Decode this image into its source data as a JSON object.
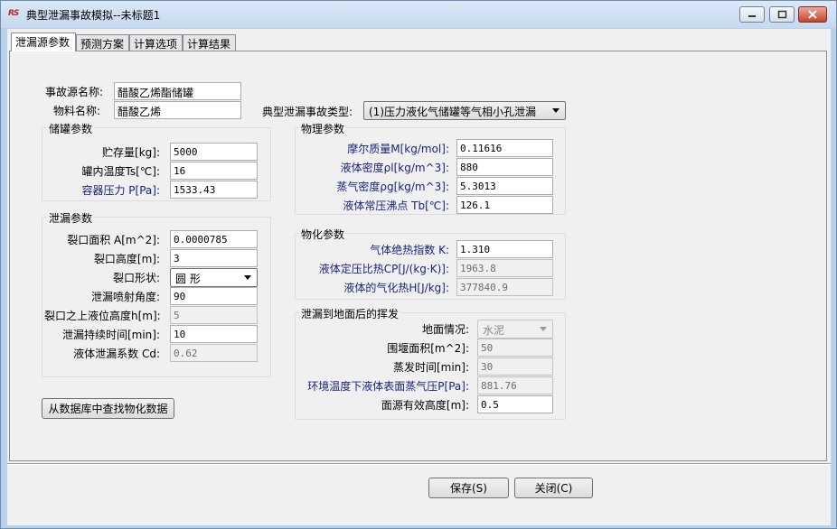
{
  "window": {
    "title": "典型泄漏事故模拟--未标题1",
    "app_icon_text": "RS"
  },
  "tabs": [
    {
      "label": "泄漏源参数",
      "active": true
    },
    {
      "label": "预测方案",
      "active": false
    },
    {
      "label": "计算选项",
      "active": false
    },
    {
      "label": "计算结果",
      "active": false
    }
  ],
  "top": {
    "source_name_label": "事故源名称:",
    "source_name_value": "醋酸乙烯酯储罐",
    "material_label": "物料名称:",
    "material_value": "醋酸乙烯",
    "leak_type_label": "典型泄漏事故类型:",
    "leak_type_value": "(1)压力液化气储罐等气相小孔泄漏"
  },
  "storage": {
    "title": "储罐参数",
    "mass_label": "贮存量[kg]:",
    "mass_value": "5000",
    "temp_label": "罐内温度Ts[℃]:",
    "temp_value": "16",
    "pressure_label": "容器压力 P[Pa]:",
    "pressure_value": "1533.43"
  },
  "leak": {
    "title": "泄漏参数",
    "area_label": "裂口面积 A[m^2]:",
    "area_value": "0.0000785",
    "height_label": "裂口高度[m]:",
    "height_value": "3",
    "shape_label": "裂口形状:",
    "shape_value": "圆  形",
    "angle_label": "泄漏喷射角度:",
    "angle_value": "90",
    "level_label": "裂口之上液位高度h[m]:",
    "level_value": "5",
    "duration_label": "泄漏持续时间[min]:",
    "duration_value": "10",
    "coef_label": "液体泄漏系数  Cd:",
    "coef_value": "0.62"
  },
  "physical": {
    "title": "物理参数",
    "molar_label": "摩尔质量M[kg/mol]:",
    "molar_value": "0.11616",
    "liquid_density_label": "液体密度ρl[kg/m^3]:",
    "liquid_density_value": "880",
    "vapor_density_label": "蒸气密度ρg[kg/m^3]:",
    "vapor_density_value": "5.3013",
    "boiling_label": "液体常压沸点 Tb[℃]:",
    "boiling_value": "126.1"
  },
  "chemical": {
    "title": "物化参数",
    "adiabatic_label": "气体绝热指数 K:",
    "adiabatic_value": "1.310",
    "cp_label": "液体定压比热CP[J/(kg·K)]:",
    "cp_value": "1963.8",
    "heat_label": "液体的气化热H[J/kg]:",
    "heat_value": "377840.9"
  },
  "evaporation": {
    "title": "泄漏到地面后的挥发",
    "ground_label": "地面情况:",
    "ground_value": "水泥",
    "dike_label": "围堰面积[m^2]:",
    "dike_value": "50",
    "evap_time_label": "蒸发时间[min]:",
    "evap_time_value": "30",
    "vapor_pressure_label": "环境温度下液体表面蒸气压P[Pa]:",
    "vapor_pressure_value": "881.76",
    "height_label": "面源有效高度[m]:",
    "height_value": "0.5"
  },
  "buttons": {
    "lookup": "从数据库中查找物化数据",
    "save": "保存(S)",
    "close": "关闭(C)"
  }
}
